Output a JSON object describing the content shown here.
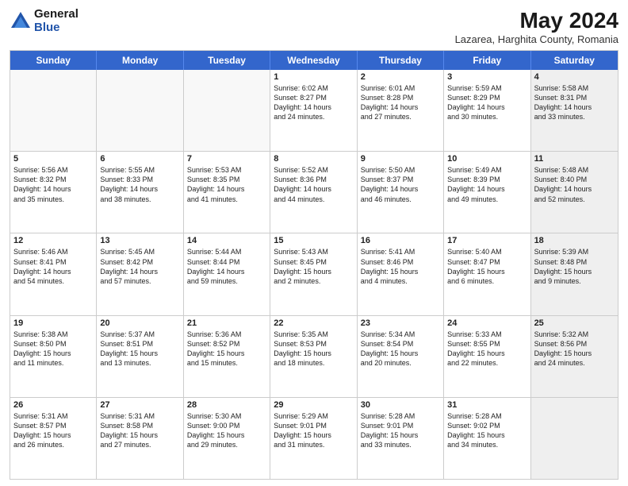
{
  "logo": {
    "general": "General",
    "blue": "Blue"
  },
  "title": {
    "month": "May 2024",
    "location": "Lazarea, Harghita County, Romania"
  },
  "header_days": [
    "Sunday",
    "Monday",
    "Tuesday",
    "Wednesday",
    "Thursday",
    "Friday",
    "Saturday"
  ],
  "weeks": [
    [
      {
        "day": "",
        "info": "",
        "empty": true
      },
      {
        "day": "",
        "info": "",
        "empty": true
      },
      {
        "day": "",
        "info": "",
        "empty": true
      },
      {
        "day": "1",
        "info": "Sunrise: 6:02 AM\nSunset: 8:27 PM\nDaylight: 14 hours\nand 24 minutes.",
        "empty": false
      },
      {
        "day": "2",
        "info": "Sunrise: 6:01 AM\nSunset: 8:28 PM\nDaylight: 14 hours\nand 27 minutes.",
        "empty": false
      },
      {
        "day": "3",
        "info": "Sunrise: 5:59 AM\nSunset: 8:29 PM\nDaylight: 14 hours\nand 30 minutes.",
        "empty": false
      },
      {
        "day": "4",
        "info": "Sunrise: 5:58 AM\nSunset: 8:31 PM\nDaylight: 14 hours\nand 33 minutes.",
        "empty": false,
        "shaded": true
      }
    ],
    [
      {
        "day": "5",
        "info": "Sunrise: 5:56 AM\nSunset: 8:32 PM\nDaylight: 14 hours\nand 35 minutes.",
        "empty": false
      },
      {
        "day": "6",
        "info": "Sunrise: 5:55 AM\nSunset: 8:33 PM\nDaylight: 14 hours\nand 38 minutes.",
        "empty": false
      },
      {
        "day": "7",
        "info": "Sunrise: 5:53 AM\nSunset: 8:35 PM\nDaylight: 14 hours\nand 41 minutes.",
        "empty": false
      },
      {
        "day": "8",
        "info": "Sunrise: 5:52 AM\nSunset: 8:36 PM\nDaylight: 14 hours\nand 44 minutes.",
        "empty": false
      },
      {
        "day": "9",
        "info": "Sunrise: 5:50 AM\nSunset: 8:37 PM\nDaylight: 14 hours\nand 46 minutes.",
        "empty": false
      },
      {
        "day": "10",
        "info": "Sunrise: 5:49 AM\nSunset: 8:39 PM\nDaylight: 14 hours\nand 49 minutes.",
        "empty": false
      },
      {
        "day": "11",
        "info": "Sunrise: 5:48 AM\nSunset: 8:40 PM\nDaylight: 14 hours\nand 52 minutes.",
        "empty": false,
        "shaded": true
      }
    ],
    [
      {
        "day": "12",
        "info": "Sunrise: 5:46 AM\nSunset: 8:41 PM\nDaylight: 14 hours\nand 54 minutes.",
        "empty": false
      },
      {
        "day": "13",
        "info": "Sunrise: 5:45 AM\nSunset: 8:42 PM\nDaylight: 14 hours\nand 57 minutes.",
        "empty": false
      },
      {
        "day": "14",
        "info": "Sunrise: 5:44 AM\nSunset: 8:44 PM\nDaylight: 14 hours\nand 59 minutes.",
        "empty": false
      },
      {
        "day": "15",
        "info": "Sunrise: 5:43 AM\nSunset: 8:45 PM\nDaylight: 15 hours\nand 2 minutes.",
        "empty": false
      },
      {
        "day": "16",
        "info": "Sunrise: 5:41 AM\nSunset: 8:46 PM\nDaylight: 15 hours\nand 4 minutes.",
        "empty": false
      },
      {
        "day": "17",
        "info": "Sunrise: 5:40 AM\nSunset: 8:47 PM\nDaylight: 15 hours\nand 6 minutes.",
        "empty": false
      },
      {
        "day": "18",
        "info": "Sunrise: 5:39 AM\nSunset: 8:48 PM\nDaylight: 15 hours\nand 9 minutes.",
        "empty": false,
        "shaded": true
      }
    ],
    [
      {
        "day": "19",
        "info": "Sunrise: 5:38 AM\nSunset: 8:50 PM\nDaylight: 15 hours\nand 11 minutes.",
        "empty": false
      },
      {
        "day": "20",
        "info": "Sunrise: 5:37 AM\nSunset: 8:51 PM\nDaylight: 15 hours\nand 13 minutes.",
        "empty": false
      },
      {
        "day": "21",
        "info": "Sunrise: 5:36 AM\nSunset: 8:52 PM\nDaylight: 15 hours\nand 15 minutes.",
        "empty": false
      },
      {
        "day": "22",
        "info": "Sunrise: 5:35 AM\nSunset: 8:53 PM\nDaylight: 15 hours\nand 18 minutes.",
        "empty": false
      },
      {
        "day": "23",
        "info": "Sunrise: 5:34 AM\nSunset: 8:54 PM\nDaylight: 15 hours\nand 20 minutes.",
        "empty": false
      },
      {
        "day": "24",
        "info": "Sunrise: 5:33 AM\nSunset: 8:55 PM\nDaylight: 15 hours\nand 22 minutes.",
        "empty": false
      },
      {
        "day": "25",
        "info": "Sunrise: 5:32 AM\nSunset: 8:56 PM\nDaylight: 15 hours\nand 24 minutes.",
        "empty": false,
        "shaded": true
      }
    ],
    [
      {
        "day": "26",
        "info": "Sunrise: 5:31 AM\nSunset: 8:57 PM\nDaylight: 15 hours\nand 26 minutes.",
        "empty": false
      },
      {
        "day": "27",
        "info": "Sunrise: 5:31 AM\nSunset: 8:58 PM\nDaylight: 15 hours\nand 27 minutes.",
        "empty": false
      },
      {
        "day": "28",
        "info": "Sunrise: 5:30 AM\nSunset: 9:00 PM\nDaylight: 15 hours\nand 29 minutes.",
        "empty": false
      },
      {
        "day": "29",
        "info": "Sunrise: 5:29 AM\nSunset: 9:01 PM\nDaylight: 15 hours\nand 31 minutes.",
        "empty": false
      },
      {
        "day": "30",
        "info": "Sunrise: 5:28 AM\nSunset: 9:01 PM\nDaylight: 15 hours\nand 33 minutes.",
        "empty": false
      },
      {
        "day": "31",
        "info": "Sunrise: 5:28 AM\nSunset: 9:02 PM\nDaylight: 15 hours\nand 34 minutes.",
        "empty": false
      },
      {
        "day": "",
        "info": "",
        "empty": true,
        "shaded": true
      }
    ]
  ]
}
